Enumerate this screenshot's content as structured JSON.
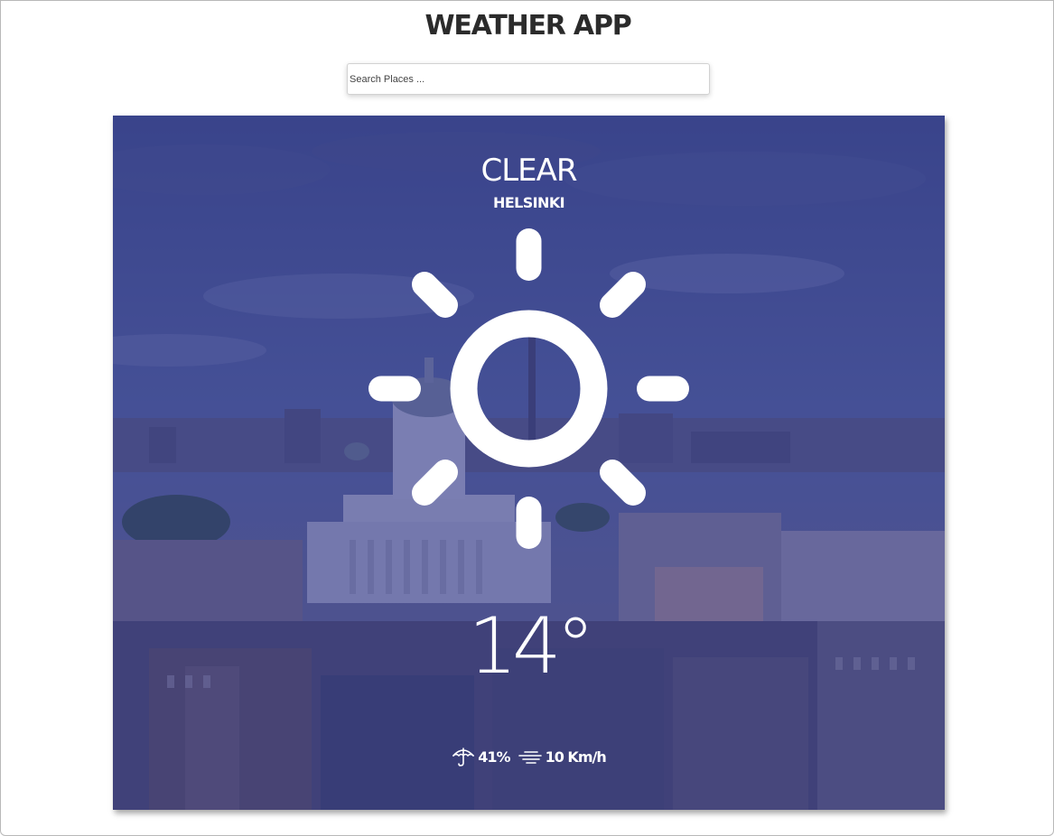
{
  "header": {
    "title": "WEATHER APP"
  },
  "search": {
    "placeholder": "Search Places ...",
    "value": ""
  },
  "weather": {
    "condition": "CLEAR",
    "city": "HELSINKI",
    "temperature": "14°",
    "icon": "sun-icon",
    "humidity": "41%",
    "humidity_icon": "umbrella-icon",
    "wind": "10 Km/h",
    "wind_icon": "wind-icon"
  },
  "colors": {
    "overlay": "#2a328c",
    "title_text": "#2b2b2b",
    "card_text": "#ffffff"
  }
}
